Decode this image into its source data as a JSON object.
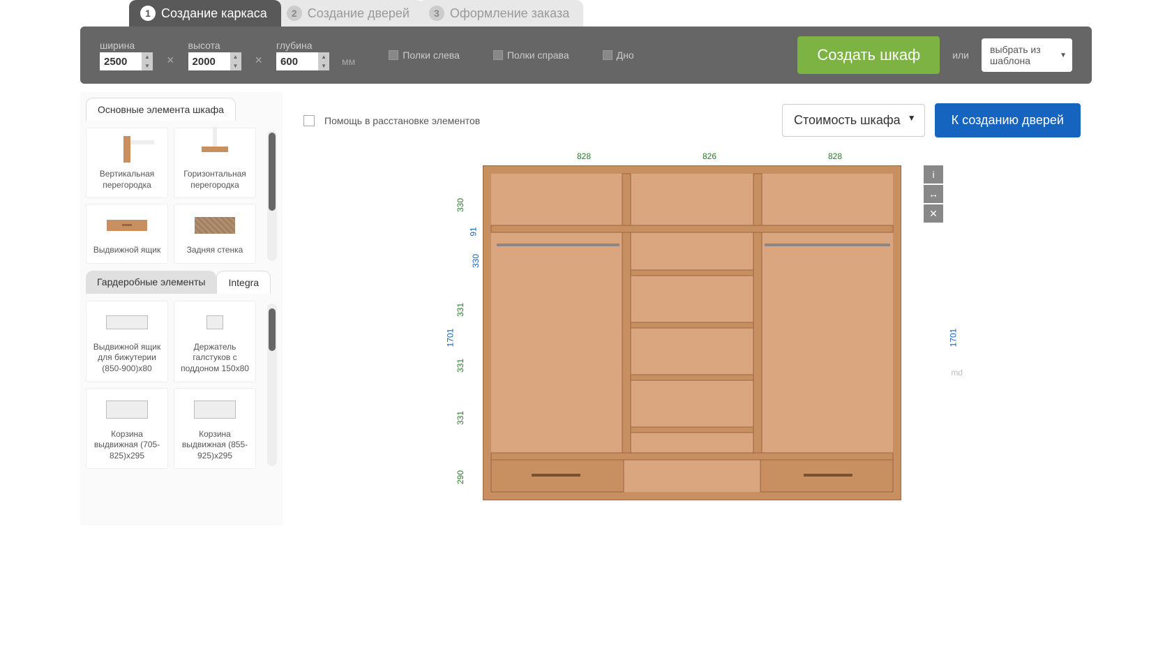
{
  "steps": [
    {
      "num": "1",
      "label": "Создание каркаса",
      "active": true
    },
    {
      "num": "2",
      "label": "Создание дверей",
      "active": false
    },
    {
      "num": "3",
      "label": "Оформление заказа",
      "active": false
    }
  ],
  "params": {
    "width_label": "ширина",
    "width": "2500",
    "height_label": "высота",
    "height": "2000",
    "depth_label": "глубина",
    "depth": "600",
    "unit": "мм"
  },
  "checks": {
    "shelves_left": "Полки слева",
    "shelves_right": "Полки справа",
    "bottom": "Дно"
  },
  "actions": {
    "create": "Создать шкаф",
    "or": "или",
    "template": "выбрать из шаблона"
  },
  "sidebar": {
    "main_tab": "Основные элемента шкафа",
    "items_main": [
      {
        "label": "Вертикальная перегородка",
        "icon": "v-divider"
      },
      {
        "label": "Горизонтальная перегородка",
        "icon": "h-divider"
      },
      {
        "label": "Выдвижной ящик",
        "icon": "drawer"
      },
      {
        "label": "Задняя стенка",
        "icon": "back-panel"
      }
    ],
    "wardrobe_tab": "Гардеробные элементы",
    "integra_tab": "Integra",
    "items_integra": [
      {
        "label": "Выдвижной ящик для бижутерии (850-900)x80"
      },
      {
        "label": "Держатель галстуков с поддоном 150x80"
      },
      {
        "label": "Корзина выдвижная (705-825)x295"
      },
      {
        "label": "Корзина выдвижная (855-925)x295"
      }
    ]
  },
  "canvas": {
    "help": "Помощь в расстановке элементов",
    "cost": "Стоимость шкафа",
    "to_doors": "К созданию дверей",
    "dims_top": [
      "828",
      "826",
      "828"
    ],
    "dims_left_green": [
      "330",
      "331",
      "331",
      "331",
      "290"
    ],
    "dims_left_blue": [
      "91",
      "330",
      "1701"
    ],
    "dims_right": "1701",
    "md": "md"
  }
}
